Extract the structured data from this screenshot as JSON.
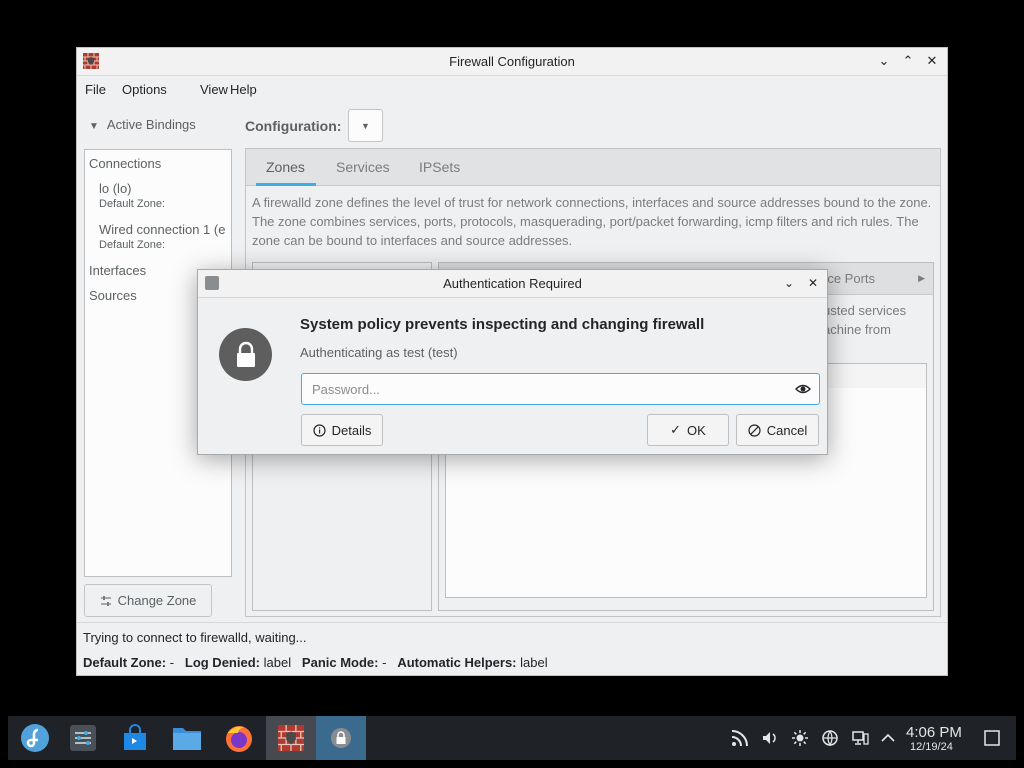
{
  "window": {
    "title": "Firewall Configuration",
    "menu": [
      "File",
      "Options",
      "View",
      "Help"
    ],
    "active_bindings": "Active Bindings",
    "connections_header": "Connections",
    "connections": [
      {
        "name": "lo (lo)",
        "zone": "Default Zone:"
      },
      {
        "name": "Wired connection 1 (e",
        "zone": "Default Zone:"
      }
    ],
    "interfaces_header": "Interfaces",
    "sources_header": "Sources",
    "change_zone": "Change Zone",
    "configuration_label": "Configuration:",
    "tabs": [
      "Zones",
      "Services",
      "IPSets"
    ],
    "zone_description": "A firewalld zone defines the level of trust for network connections, interfaces and source addresses bound to the zone. The zone combines services, ports, protocols, masquerading, port/packet forwarding, icmp filters and rich rules. The zone can be bound to interfaces and source addresses.",
    "subtab_partial": "rce Ports",
    "partial_desc_1": "usted services",
    "partial_desc_2": "achine from",
    "status_message": "Trying to connect to firewalld, waiting...",
    "status_bar": {
      "default_zone_label": "Default Zone:",
      "default_zone_value": "-",
      "log_denied_label": "Log Denied:",
      "log_denied_value": "label",
      "panic_mode_label": "Panic Mode:",
      "panic_mode_value": "-",
      "auto_helpers_label": "Automatic Helpers:",
      "auto_helpers_value": "label"
    }
  },
  "dialog": {
    "title": "Authentication Required",
    "heading": "System policy prevents inspecting and changing firewall",
    "subtext": "Authenticating as test (test)",
    "password_placeholder": "Password...",
    "details": "Details",
    "ok": "OK",
    "cancel": "Cancel"
  },
  "taskbar": {
    "time": "4:06 PM",
    "date": "12/19/24"
  },
  "colors": {
    "accent": "#3daee9",
    "panel": "#1f2227",
    "window_bg": "#eff0f1"
  }
}
